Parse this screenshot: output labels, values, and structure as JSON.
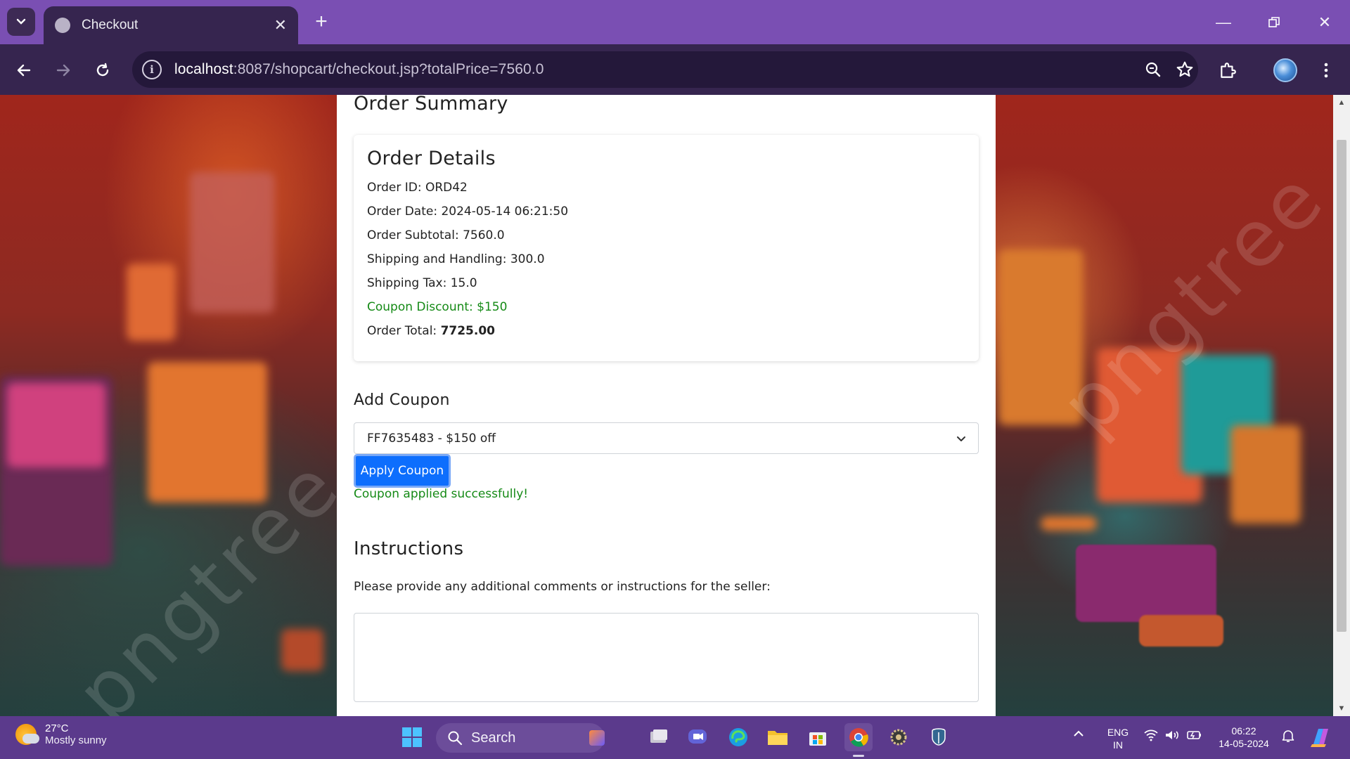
{
  "browser": {
    "tab_title": "Checkout",
    "url_host": "localhost",
    "url_path": ":8087/shopcart/checkout.jsp?totalPrice=7560.0"
  },
  "page": {
    "summary_heading": "Order Summary",
    "details": {
      "heading": "Order Details",
      "order_id": "Order ID: ORD42",
      "order_date": "Order Date: 2024-05-14 06:21:50",
      "subtotal": "Order Subtotal: 7560.0",
      "shipping": "Shipping and Handling: 300.0",
      "tax": "Shipping Tax: 15.0",
      "coupon_discount": "Coupon Discount: $150",
      "total_label": "Order Total: ",
      "total_value": "7725.00"
    },
    "coupon": {
      "heading": "Add Coupon",
      "selected_option": "FF7635483 - $150 off",
      "apply_label": "Apply Coupon",
      "success_message": "Coupon applied successfully!"
    },
    "instructions": {
      "heading": "Instructions",
      "label": "Please provide any additional comments or instructions for the seller:",
      "value": ""
    },
    "background_watermark": "pngtree"
  },
  "taskbar": {
    "temperature": "27°C",
    "weather": "Mostly sunny",
    "search_label": "Search",
    "lang_1": "ENG",
    "lang_2": "IN",
    "time": "06:22",
    "date": "14-05-2024"
  },
  "colors": {
    "chrome_purple": "#7a4fb3",
    "toolbar": "#36254f",
    "primary_button": "#0d6efd",
    "success_green": "#158a16"
  }
}
